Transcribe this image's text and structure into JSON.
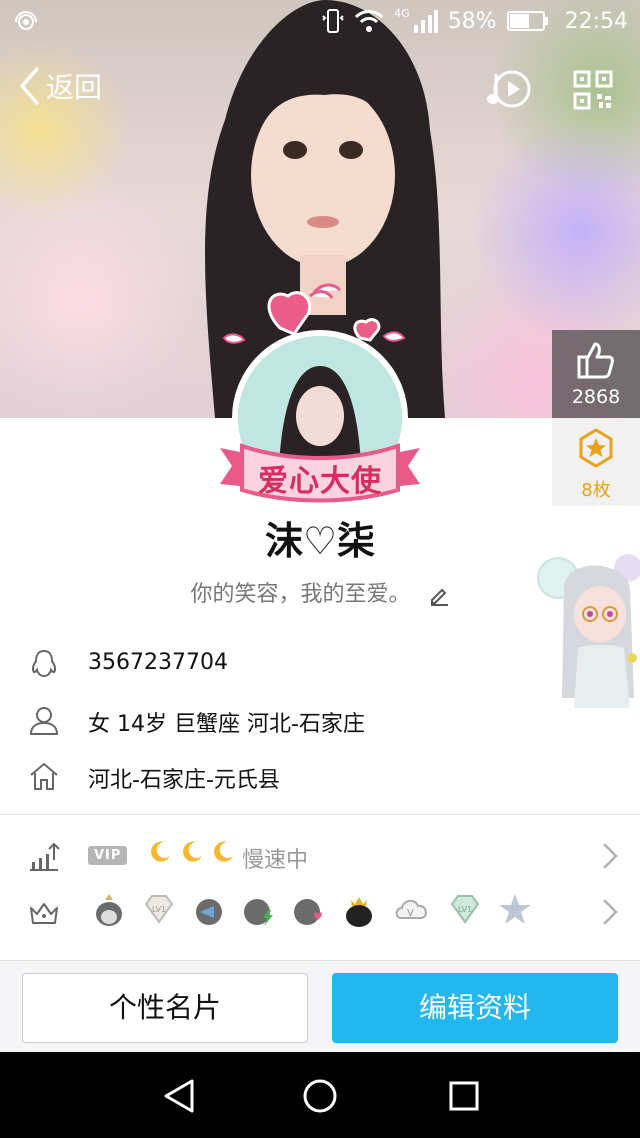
{
  "status_bar": {
    "network": "4G",
    "battery_percent": "58%",
    "battery_level": 0.58,
    "time": "22:54"
  },
  "nav": {
    "back_label": "返回",
    "icons": [
      "music-icon",
      "qr-code-icon"
    ]
  },
  "stats": {
    "likes": "2868",
    "medals": "8枚"
  },
  "profile": {
    "badge_text": "爱心大使",
    "nickname": "沫♡柒",
    "signature": "你的笑容，我的至爱。"
  },
  "info": {
    "qq_number": "3567237704",
    "basic": "女  14岁  巨蟹座  河北-石家庄",
    "hometown": "河北-石家庄-元氏县"
  },
  "vip": {
    "badge": "VIP",
    "moons": "🌙🌙🌙",
    "speed": "慢速中"
  },
  "achievements": {
    "icons": [
      "penguin-crown-icon",
      "diamond-lv1-icon",
      "penguin-fish-icon",
      "penguin-lightning-icon",
      "penguin-heart-icon",
      "penguin-black-crown-icon",
      "cloud-v-icon",
      "green-diamond-lv1-icon",
      "star-icon"
    ]
  },
  "actions": {
    "card_label": "个性名片",
    "edit_label": "编辑资料"
  },
  "colors": {
    "accent": "#23b7ef",
    "medal": "#e9a21c"
  }
}
